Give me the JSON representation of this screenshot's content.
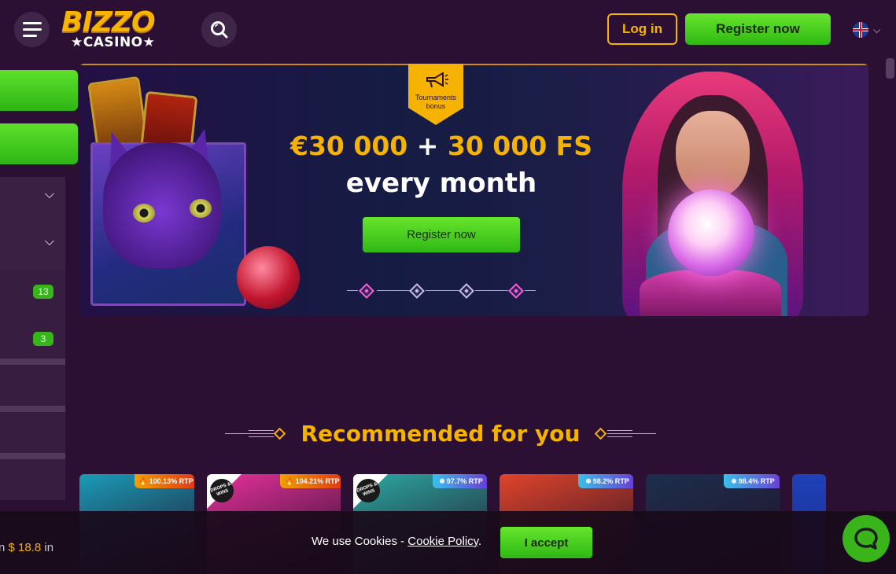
{
  "header": {
    "logo_top": "BIZZO",
    "logo_bottom": "★CASINO★",
    "login_label": "Log in",
    "register_label": "Register now"
  },
  "sidebar": {
    "badges": [
      "13",
      "3"
    ]
  },
  "banner": {
    "tag_label": "Tournaments bonus",
    "headline_amount": "€30 000",
    "headline_plus": " + ",
    "headline_fs": "30 000 FS",
    "headline_sub": "every month",
    "cta_label": "Register now"
  },
  "recommended": {
    "title": "Recommended for you",
    "games": [
      {
        "rtp": "100.13% RTP",
        "rtp_kind": "hot",
        "drops": false,
        "bg": "#1a9bb8"
      },
      {
        "rtp": "104.21% RTP",
        "rtp_kind": "hot",
        "drops": true,
        "bg": "#e7309c"
      },
      {
        "rtp": "97.7% RTP",
        "rtp_kind": "cold",
        "drops": true,
        "bg": "#2ba9a2"
      },
      {
        "rtp": "98.2% RTP",
        "rtp_kind": "cold",
        "drops": false,
        "bg": "#e0442a"
      },
      {
        "rtp": "98.4% RTP",
        "rtp_kind": "cold",
        "drops": false,
        "bg": "#1c2f4d"
      }
    ],
    "drops_label": "DROPS & WINS"
  },
  "cookie": {
    "left_prefix": "n ",
    "left_amount": "$ 18.8",
    "left_suffix": " in",
    "text": "We use Cookies - ",
    "policy_link": "Cookie Policy",
    "text_end": ".",
    "accept_label": "I accept"
  },
  "colors": {
    "background": "#2b1033",
    "accent_gold": "#f5b300",
    "accent_green": "#39b51b"
  }
}
